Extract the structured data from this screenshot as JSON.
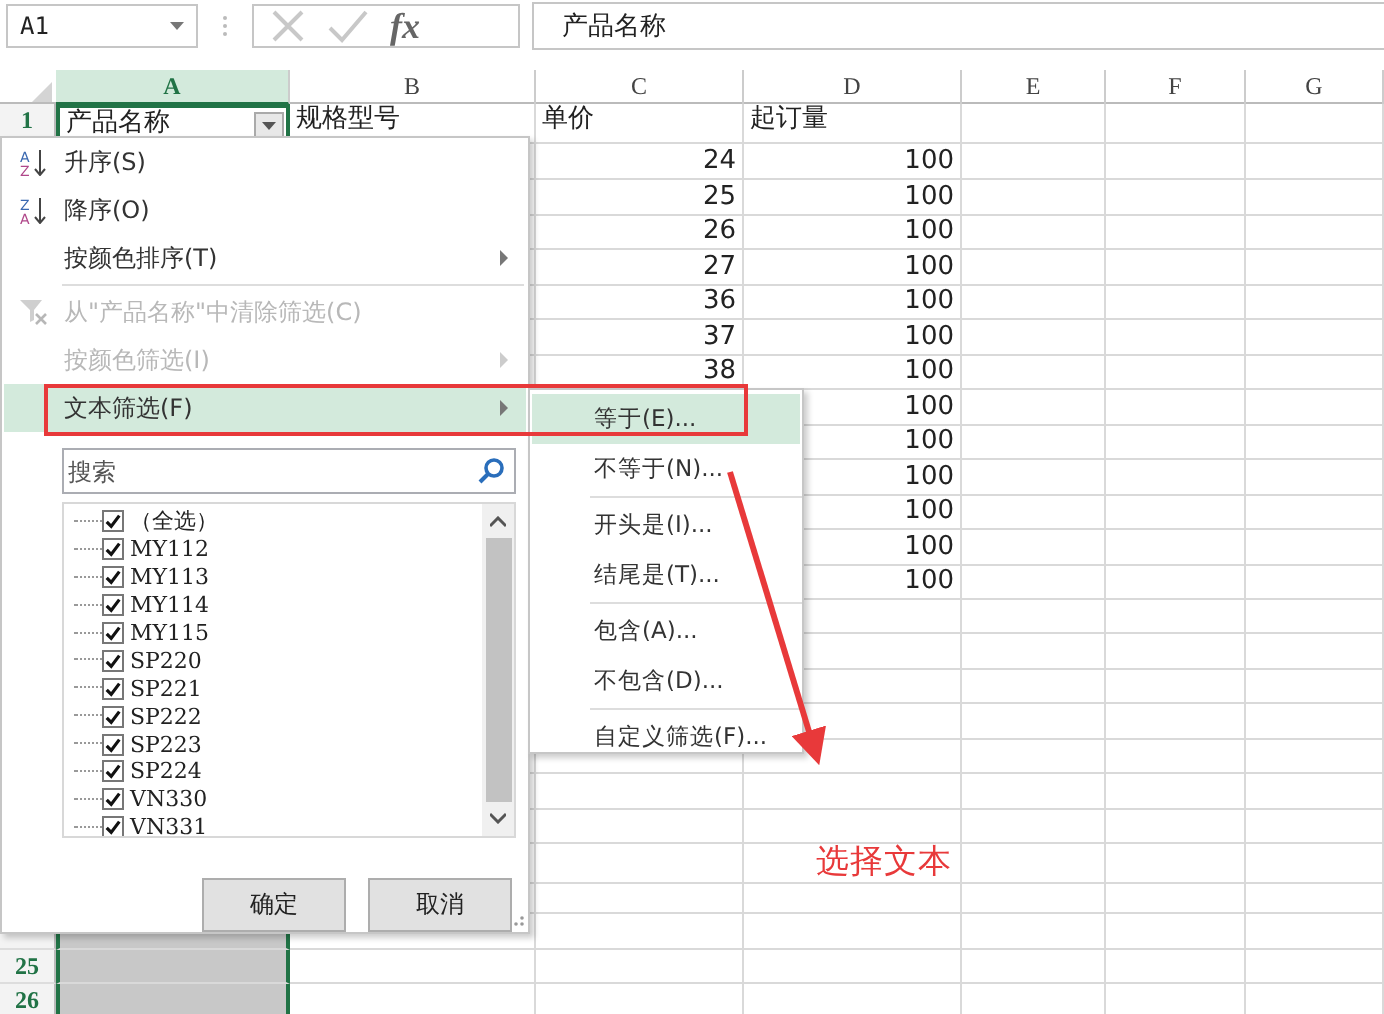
{
  "formula_bar": {
    "name_box": "A1",
    "function_label": "fx",
    "formula": "产品名称"
  },
  "columns": [
    {
      "label": "A",
      "selected": true
    },
    {
      "label": "B",
      "selected": false
    },
    {
      "label": "C",
      "selected": false
    },
    {
      "label": "D",
      "selected": false
    },
    {
      "label": "E",
      "selected": false
    },
    {
      "label": "F",
      "selected": false
    },
    {
      "label": "G",
      "selected": false
    }
  ],
  "rows": [
    {
      "kind": "header",
      "number": "1",
      "product": "产品名称",
      "model": "规格型号",
      "price": "单价",
      "moq": "起订量"
    },
    {
      "kind": "data",
      "price": "24",
      "moq": "100"
    },
    {
      "kind": "data",
      "price": "25",
      "moq": "100"
    },
    {
      "kind": "data",
      "price": "26",
      "moq": "100"
    },
    {
      "kind": "data",
      "price": "27",
      "moq": "100"
    },
    {
      "kind": "data",
      "price": "36",
      "moq": "100"
    },
    {
      "kind": "data",
      "price": "37",
      "moq": "100"
    },
    {
      "kind": "data",
      "price": "38",
      "moq": "100"
    },
    {
      "kind": "data",
      "moq": "100"
    },
    {
      "kind": "data",
      "moq": "100"
    },
    {
      "kind": "data",
      "moq": "100"
    },
    {
      "kind": "data",
      "moq": "100"
    },
    {
      "kind": "data",
      "moq": "100"
    },
    {
      "kind": "data",
      "moq": "100"
    },
    {
      "kind": "data"
    },
    {
      "kind": "data"
    },
    {
      "kind": "data"
    },
    {
      "kind": "data"
    },
    {
      "kind": "data"
    },
    {
      "kind": "data"
    },
    {
      "kind": "data"
    },
    {
      "kind": "data"
    },
    {
      "kind": "data"
    },
    {
      "kind": "data"
    },
    {
      "kind": "data",
      "number": "25"
    },
    {
      "kind": "data",
      "number": "26"
    }
  ],
  "filter_menu": {
    "items": [
      {
        "kind": "ascending",
        "icon_letters": [
          "A",
          "Z"
        ],
        "label": "升序(S)",
        "disabled": false,
        "submenu": false,
        "selected": false
      },
      {
        "kind": "descending",
        "icon_letters": [
          "Z",
          "A"
        ],
        "label": "降序(O)",
        "disabled": false,
        "submenu": false,
        "selected": false
      },
      {
        "kind": "plain",
        "label": "按颜色排序(T)",
        "disabled": false,
        "submenu": true,
        "selected": false
      },
      {
        "kind": "separator"
      },
      {
        "kind": "clear",
        "label": "从\"产品名称\"中清除筛选(C)",
        "disabled": true,
        "submenu": false,
        "selected": false
      },
      {
        "kind": "plain",
        "label": "按颜色筛选(I)",
        "disabled": true,
        "submenu": true,
        "selected": false
      },
      {
        "kind": "plain",
        "label": "文本筛选(F)",
        "disabled": false,
        "submenu": true,
        "selected": true
      }
    ],
    "search": {
      "placeholder": "搜索"
    },
    "values": [
      {
        "label": "（全选）",
        "checked": true
      },
      {
        "label": "MY112",
        "checked": true
      },
      {
        "label": "MY113",
        "checked": true
      },
      {
        "label": "MY114",
        "checked": true
      },
      {
        "label": "MY115",
        "checked": true
      },
      {
        "label": "SP220",
        "checked": true
      },
      {
        "label": "SP221",
        "checked": true
      },
      {
        "label": "SP222",
        "checked": true
      },
      {
        "label": "SP223",
        "checked": true
      },
      {
        "label": "SP224",
        "checked": true
      },
      {
        "label": "VN330",
        "checked": true
      },
      {
        "label": "VN331",
        "checked": true
      }
    ],
    "buttons": [
      "确定",
      "取消"
    ]
  },
  "text_filter_submenu": {
    "items": [
      {
        "kind": "item",
        "label": "等于(E)...",
        "selected": true
      },
      {
        "kind": "item",
        "label": "不等于(N)...",
        "selected": false
      },
      {
        "kind": "separator"
      },
      {
        "kind": "item",
        "label": "开头是(I)...",
        "selected": false
      },
      {
        "kind": "item",
        "label": "结尾是(T)...",
        "selected": false
      },
      {
        "kind": "separator"
      },
      {
        "kind": "item",
        "label": "包含(A)...",
        "selected": false
      },
      {
        "kind": "item",
        "label": "不包含(D)...",
        "selected": false
      },
      {
        "kind": "separator"
      },
      {
        "kind": "item",
        "label": "自定义筛选(F)...",
        "selected": false
      }
    ]
  },
  "annotation": {
    "text": "选择文本"
  }
}
